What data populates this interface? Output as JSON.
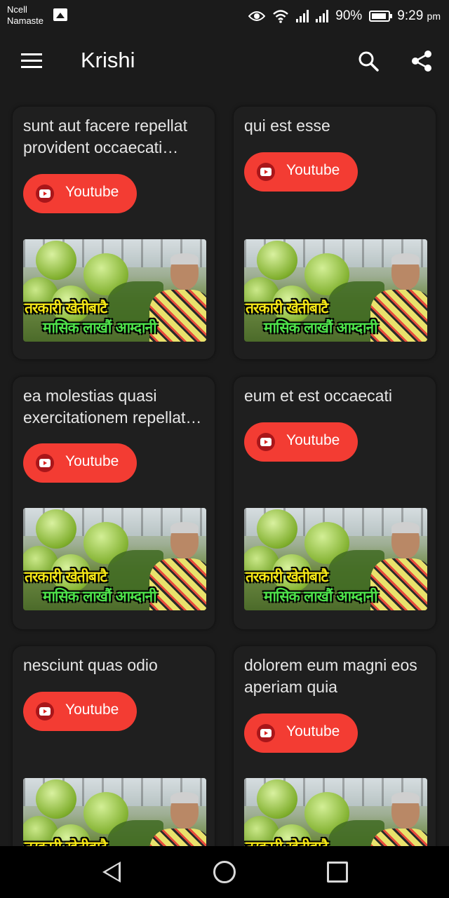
{
  "status_bar": {
    "carrier_line1": "Ncell",
    "carrier_line2": "Namaste",
    "battery_percent": "90%",
    "time": "9:29",
    "time_suffix": "pm",
    "icons": [
      "gallery-icon",
      "eye-icon",
      "wifi-icon",
      "signal-icon",
      "signal-icon",
      "battery-icon"
    ]
  },
  "app_bar": {
    "title": "Krishi",
    "icons": [
      "menu-icon",
      "search-icon",
      "share-icon"
    ]
  },
  "button_label": "Youtube",
  "thumbnail_caption_line1": "तरकारी खेतीबाटै",
  "thumbnail_caption_line2": "मासिक लाखौं आम्दानी",
  "cards": [
    {
      "title": "sunt aut facere repellat provident occaecati excepturi optio reprehenderit",
      "button": "Youtube"
    },
    {
      "title": "qui est esse",
      "button": "Youtube"
    },
    {
      "title": "ea molestias quasi exercitationem repellat qui ipsa sit aut",
      "button": "Youtube"
    },
    {
      "title": "eum et est occaecati",
      "button": "Youtube"
    },
    {
      "title": "nesciunt quas odio",
      "button": "Youtube"
    },
    {
      "title": "dolorem eum magni eos aperiam quia",
      "button": "Youtube"
    }
  ],
  "colors": {
    "background": "#1b1b1b",
    "card": "#1f1f1f",
    "button": "#f33c33",
    "caption_yellow": "#f2e516",
    "caption_green": "#4ee24a"
  },
  "nav_bar": {
    "icons": [
      "back-icon",
      "home-icon",
      "recents-icon"
    ]
  }
}
